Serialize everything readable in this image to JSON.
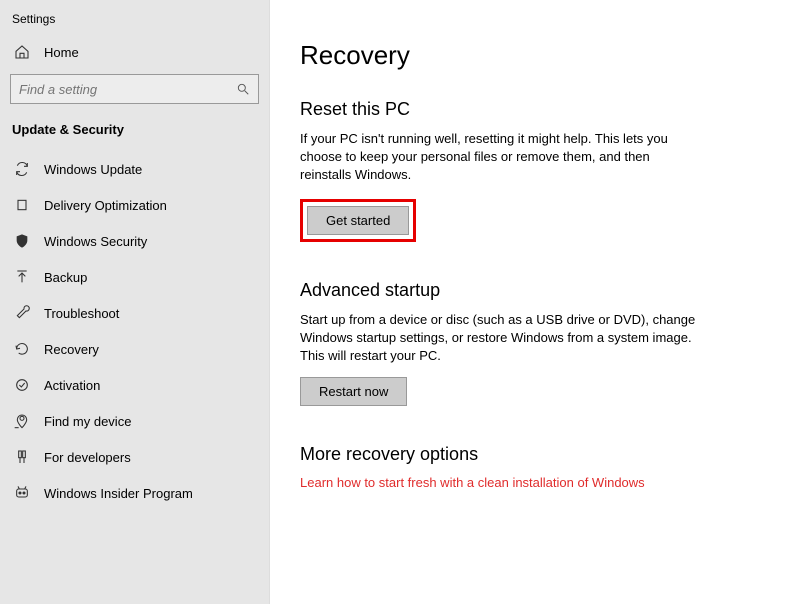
{
  "app_title": "Settings",
  "home_label": "Home",
  "search": {
    "placeholder": "Find a setting"
  },
  "section_label": "Update & Security",
  "nav": [
    {
      "label": "Windows Update"
    },
    {
      "label": "Delivery Optimization"
    },
    {
      "label": "Windows Security"
    },
    {
      "label": "Backup"
    },
    {
      "label": "Troubleshoot"
    },
    {
      "label": "Recovery"
    },
    {
      "label": "Activation"
    },
    {
      "label": "Find my device"
    },
    {
      "label": "For developers"
    },
    {
      "label": "Windows Insider Program"
    }
  ],
  "page_title": "Recovery",
  "reset": {
    "heading": "Reset this PC",
    "desc": "If your PC isn't running well, resetting it might help. This lets you choose to keep your personal files or remove them, and then reinstalls Windows.",
    "button": "Get started"
  },
  "advanced": {
    "heading": "Advanced startup",
    "desc": "Start up from a device or disc (such as a USB drive or DVD), change Windows startup settings, or restore Windows from a system image. This will restart your PC.",
    "button": "Restart now"
  },
  "more": {
    "heading": "More recovery options",
    "link": "Learn how to start fresh with a clean installation of Windows"
  }
}
